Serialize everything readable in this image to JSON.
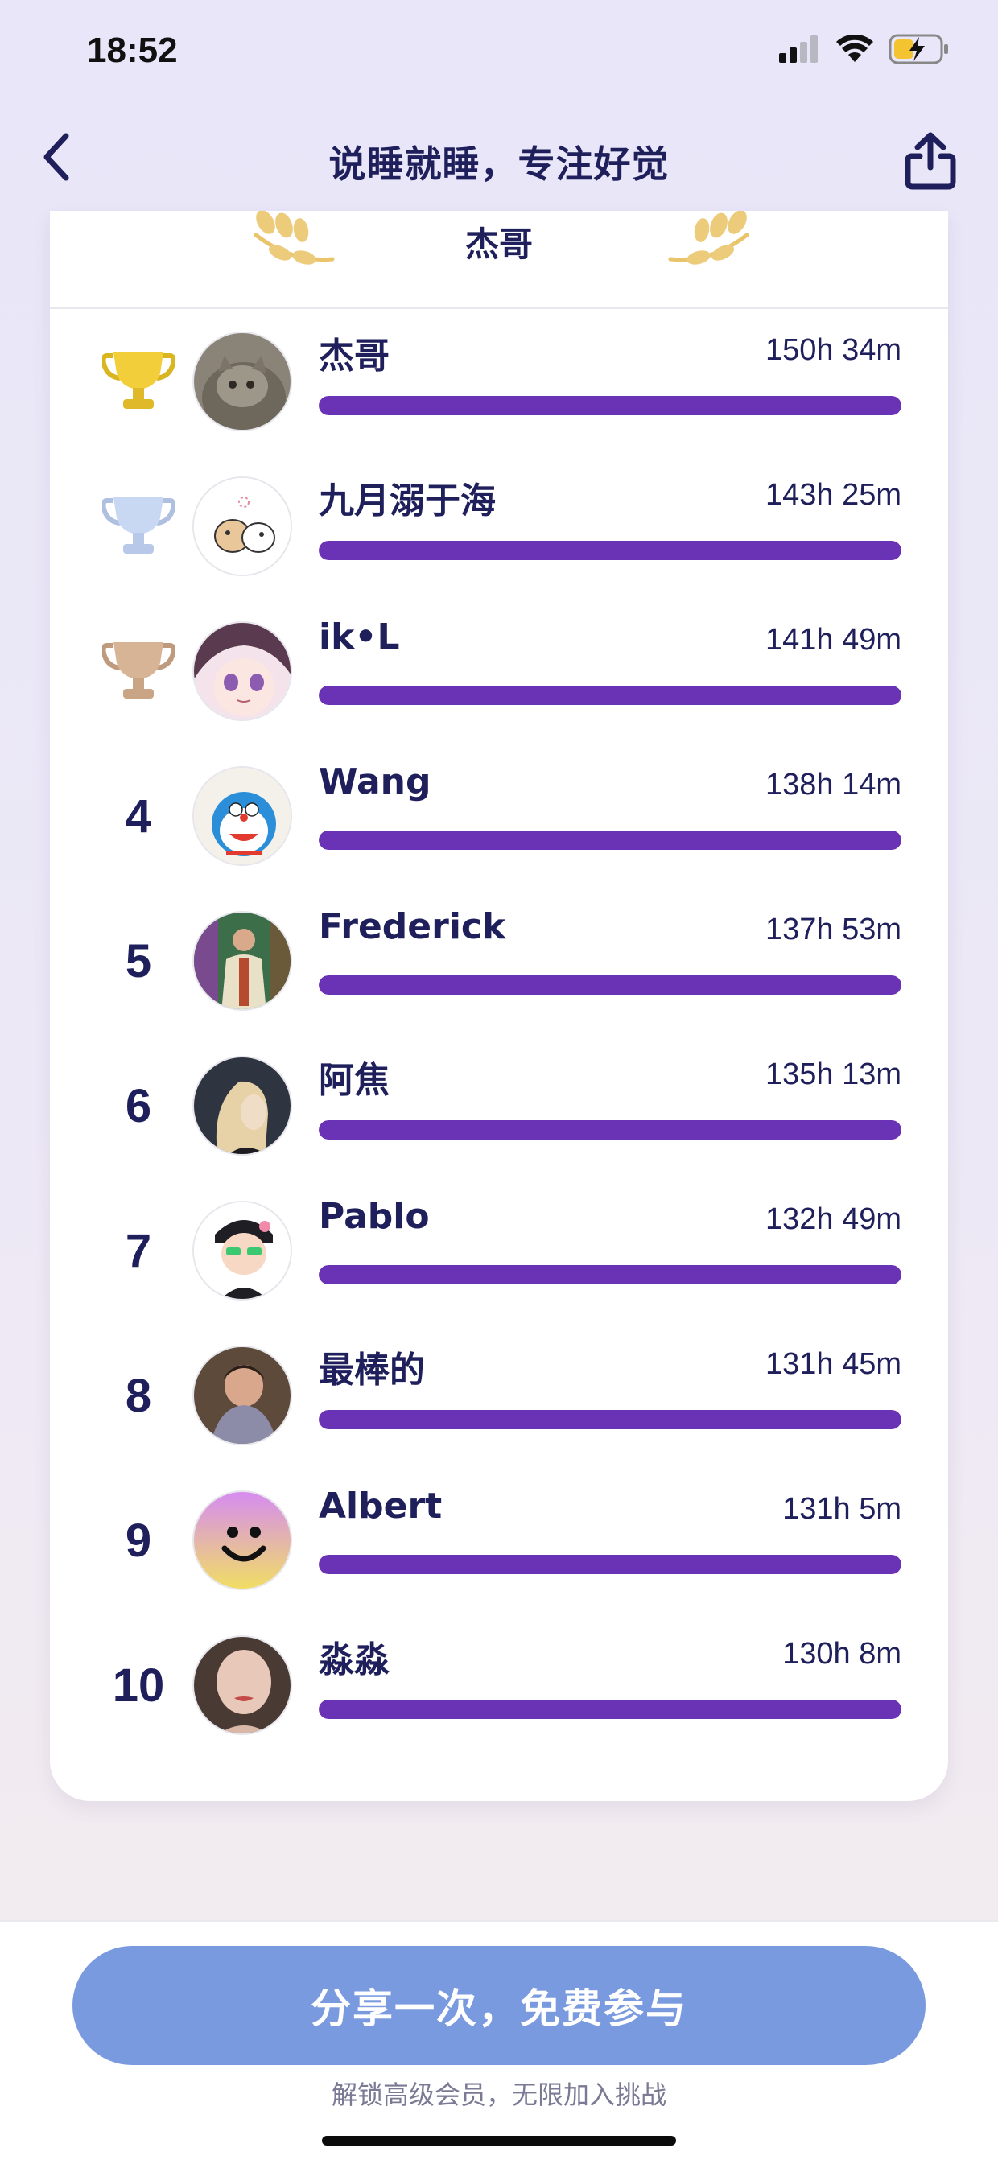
{
  "status_bar": {
    "time": "18:52"
  },
  "nav": {
    "title": "说睡就睡，专注好觉"
  },
  "card": {
    "header_name": "杰哥",
    "entries": [
      {
        "rank": "1",
        "medal": "gold-trophy-icon",
        "name": "杰哥",
        "time": "150h 34m",
        "progress": 1.0
      },
      {
        "rank": "2",
        "medal": "silver-trophy-icon",
        "name": "九月溺于海",
        "time": "143h 25m",
        "progress": 1.0
      },
      {
        "rank": "3",
        "medal": "bronze-trophy-icon",
        "name": "ik•L",
        "time": "141h 49m",
        "progress": 1.0
      },
      {
        "rank": "4",
        "name": "Wang",
        "time": "138h 14m",
        "progress": 1.0
      },
      {
        "rank": "5",
        "name": "Frederick",
        "time": "137h 53m",
        "progress": 1.0
      },
      {
        "rank": "6",
        "name": "阿焦",
        "time": "135h 13m",
        "progress": 1.0
      },
      {
        "rank": "7",
        "name": "Pablo",
        "time": "132h 49m",
        "progress": 1.0
      },
      {
        "rank": "8",
        "name": "最棒的",
        "time": "131h 45m",
        "progress": 1.0
      },
      {
        "rank": "9",
        "name": "Albert",
        "time": "131h 5m",
        "progress": 1.0
      },
      {
        "rank": "10",
        "name": "淼淼",
        "time": "130h 8m",
        "progress": 1.0
      }
    ]
  },
  "cta": {
    "label": "分享一次，免费参与",
    "subtitle": "解锁高级会员，无限加入挑战"
  },
  "colors": {
    "accent": "#6a32b4",
    "title": "#1f1f5c",
    "cta": "#7a9ae0",
    "gold": "#f2cf3a",
    "silver": "#c9d8f2",
    "bronze": "#d8b497"
  }
}
